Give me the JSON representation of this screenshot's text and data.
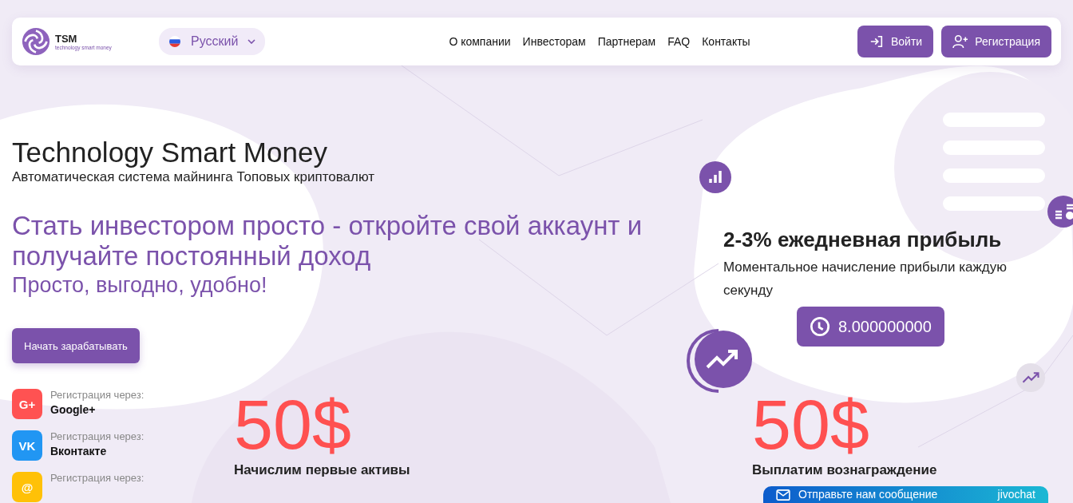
{
  "header": {
    "logo": {
      "name": "TSM",
      "tagline": "technology smart money"
    },
    "language": {
      "label": "Русский"
    },
    "nav": [
      {
        "label": "О компании"
      },
      {
        "label": "Инвесторам"
      },
      {
        "label": "Партнерам"
      },
      {
        "label": "FAQ"
      },
      {
        "label": "Контакты"
      }
    ],
    "buttons": [
      {
        "kind": "login",
        "label": "Войти"
      },
      {
        "kind": "register",
        "label": "Регистрация"
      }
    ]
  },
  "hero": {
    "title": "Technology Smart Money",
    "subtitle": "Автоматическая система майнинга Топовых криптовалют",
    "headline": "Стать инвестором просто - откройте свой аккаунт и получайте постоянный доход",
    "tagline": "Просто, выгодно, удобно!",
    "cta": "Начать зарабатывать"
  },
  "social": [
    {
      "badge": "G+",
      "caption": "Регистрация через:",
      "name": "Google+",
      "color": "#ff5252"
    },
    {
      "badge": "VK",
      "caption": "Регистрация через:",
      "name": "Вконтакте",
      "color": "#2196f3"
    },
    {
      "badge": "@",
      "caption": "Регистрация через:",
      "color": "#ffc107"
    }
  ],
  "profit": {
    "title": "2-3% ежедневная прибыль",
    "text": "Моментальное начисление прибыли каждую секунду",
    "counter": "8.000000000"
  },
  "bonuses": [
    {
      "amount": "50$",
      "text": "Начислим первые активы"
    },
    {
      "amount": "50$",
      "text": "Выплатим вознаграждение"
    }
  ],
  "chat": {
    "label": "Отправьте нам сообщение",
    "brand": "jivochat"
  }
}
